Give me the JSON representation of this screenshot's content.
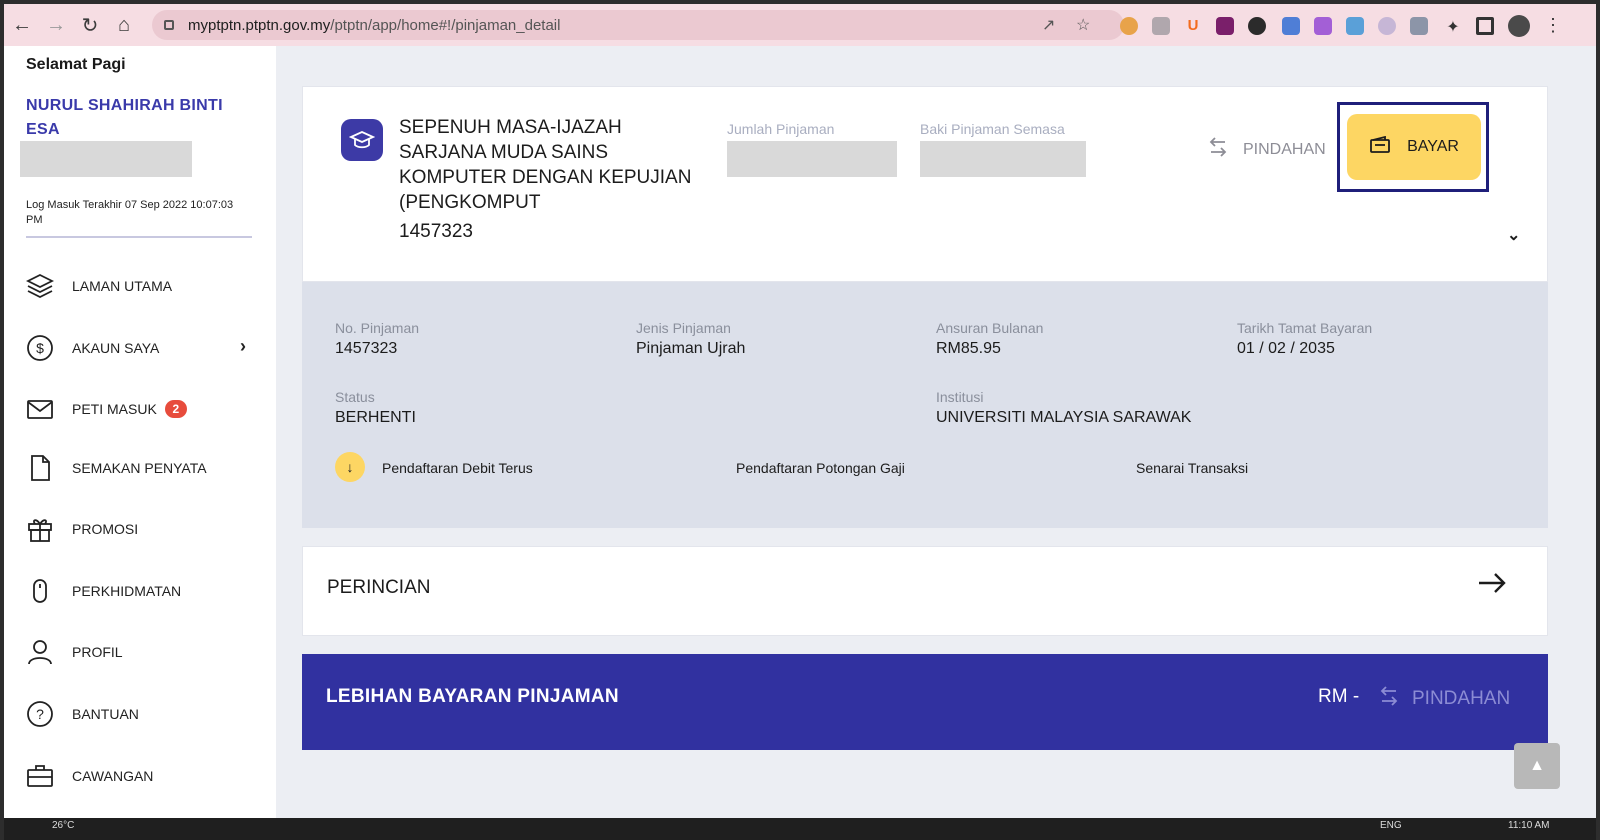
{
  "browser": {
    "url_domain": "myptptn.ptptn.gov.my",
    "url_path": "/ptptn/app/home#!/pinjaman_detail",
    "nav_icons": [
      "back-arrow-icon",
      "forward-arrow-icon",
      "reload-icon",
      "home-icon"
    ]
  },
  "sidebar": {
    "greeting": "Selamat Pagi",
    "user_name": "NURUL SHAHIRAH BINTI ESA",
    "last_login": "Log Masuk Terakhir 07 Sep 2022 10:07:03 PM",
    "items": [
      {
        "label": "LAMAN UTAMA",
        "icon": "layers-icon"
      },
      {
        "label": "AKAUN SAYA",
        "icon": "dollar-circle-icon"
      },
      {
        "label": "PETI MASUK",
        "icon": "mail-icon",
        "badge": "2"
      },
      {
        "label": "SEMAKAN PENYATA",
        "icon": "document-icon"
      },
      {
        "label": "PROMOSI",
        "icon": "gift-icon"
      },
      {
        "label": "PERKHIDMATAN",
        "icon": "mouse-icon"
      },
      {
        "label": "PROFIL",
        "icon": "user-icon"
      },
      {
        "label": "BANTUAN",
        "icon": "help-circle-icon"
      },
      {
        "label": "CAWANGAN",
        "icon": "briefcase-icon"
      }
    ]
  },
  "loan": {
    "title": "SEPENUH MASA-IJAZAH SARJANA MUDA SAINS KOMPUTER DENGAN KEPUJIAN (PENGKOMPUT",
    "number": "1457323",
    "jumlah_label": "Jumlah Pinjaman",
    "baki_label": "Baki Pinjaman Semasa",
    "pindahan_label": "PINDAHAN",
    "bayar_label": "BAYAR"
  },
  "details": {
    "no_pinjaman_label": "No. Pinjaman",
    "no_pinjaman_value": "1457323",
    "jenis_label": "Jenis Pinjaman",
    "jenis_value": "Pinjaman Ujrah",
    "ansuran_label": "Ansuran Bulanan",
    "ansuran_value": "RM85.95",
    "tarikh_label": "Tarikh Tamat Bayaran",
    "tarikh_value": "01 / 02 / 2035",
    "status_label": "Status",
    "status_value": "BERHENTI",
    "institusi_label": "Institusi",
    "institusi_value": "UNIVERSITI MALAYSIA SARAWAK",
    "links": [
      "Pendaftaran Debit Terus",
      "Pendaftaran Potongan Gaji",
      "Senarai Transaksi"
    ]
  },
  "perincian": {
    "title": "PERINCIAN"
  },
  "lebihan": {
    "title": "LEBIHAN BAYARAN PINJAMAN",
    "amount": "RM -",
    "pindahan_label": "PINDAHAN"
  },
  "taskbar": {
    "weather": "26°C",
    "lang": "ENG",
    "time": "11:10 AM"
  },
  "colors": {
    "primary": "#3131a0",
    "accent_yellow": "#fdd663",
    "highlight_frame": "#1f1f7a",
    "badge_red": "#e74c3c",
    "chrome_bar": "#f6dde3"
  }
}
